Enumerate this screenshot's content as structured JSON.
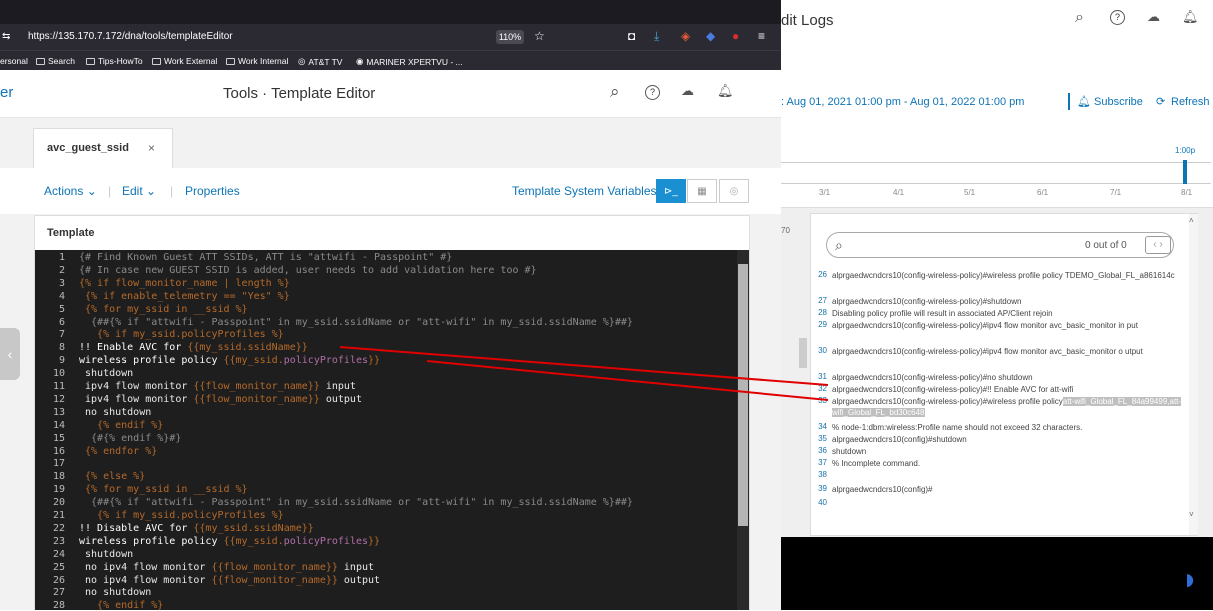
{
  "browser": {
    "url": "https://135.170.7.172/dna/tools/templateEditor",
    "zoom": "110%",
    "bookmarks": [
      "ersonal",
      "Search",
      "Tips-HowTo",
      "Work External",
      "Work Internal",
      "AT&T TV",
      "MARINER XPERTVU - ..."
    ]
  },
  "right_panel": {
    "title": "dit Logs",
    "date_range": ": Aug 01, 2021 01:00 pm - Aug 01, 2022 01:00 pm",
    "subscribe": "Subscribe",
    "refresh": "Refresh",
    "timeline_end": "1:00p",
    "ticks": [
      "3/1",
      "4/1",
      "5/1",
      "6/1",
      "7/1",
      "8/1"
    ],
    "side_num": "70",
    "search_count": "0 out of 0",
    "cli": [
      {
        "n": "26",
        "t": "alprgaedwcndcrs10(config-wireless-policy)#wireless profile policy TDEMO_Global_FL_a861614c"
      },
      {
        "n": "27",
        "t": "alprgaedwcndcrs10(config-wireless-policy)#shutdown"
      },
      {
        "n": "28",
        "t": "Disabling policy profile will result in associated AP/Client rejoin"
      },
      {
        "n": "29",
        "t": "alprgaedwcndcrs10(config-wireless-policy)#ipv4 flow monitor avc_basic_monitor in put"
      },
      {
        "n": "30",
        "t": "alprgaedwcndcrs10(config-wireless-policy)#ipv4 flow monitor avc_basic_monitor o utput"
      },
      {
        "n": "31",
        "t": "alprgaedwcndcrs10(config-wireless-policy)#no shutdown"
      },
      {
        "n": "32",
        "t": "alprgaedwcndcrs10(config-wireless-policy)#!! Enable AVC for att-wifi"
      },
      {
        "n": "33",
        "t": "alprgaedwcndcrs10(config-wireless-policy)#wireless profile policy",
        "hl": "att-wifi_Global_FL_84a99499,att-wifi_Global_FL_bd30c648"
      },
      {
        "n": "34",
        "t": "% node-1:dbm:wireless:Profile name should not exceed 32 characters."
      },
      {
        "n": "35",
        "t": "alprgaedwcndcrs10(config)#shutdown"
      },
      {
        "n": "36",
        "t": "shutdown"
      },
      {
        "n": "37",
        "t": "% Incomplete command."
      },
      {
        "n": "38",
        "t": ""
      },
      {
        "n": "39",
        "t": "alprgaedwcndcrs10(config)#"
      },
      {
        "n": "40",
        "t": ""
      }
    ]
  },
  "editor": {
    "app_fragment": "er",
    "title": "Tools · Template Editor",
    "tab": "avc_guest_ssid",
    "actions": "Actions",
    "edit": "Edit",
    "properties": "Properties",
    "sys_vars": "Template System Variables",
    "panel_title": "Template",
    "lines": [
      {
        "n": "1",
        "h": "<span class='c'>{# Find Known Guest ATT SSIDs, ATT is \"attwifi - Passpoint\" #}</span>"
      },
      {
        "n": "2",
        "h": "<span class='c'>{# In case new GUEST SSID is added, user needs to add validation here too #}</span>"
      },
      {
        "n": "3",
        "h": "<span class='o'>{% if flow_monitor_name | length %}</span>"
      },
      {
        "n": "4",
        "h": "<span class='o'> {% if enable_telemetry == \"Yes\" %}</span>"
      },
      {
        "n": "5",
        "h": "<span class='o'> {% for my_ssid in __ssid %}</span>"
      },
      {
        "n": "6",
        "h": "<span class='c'>  {##{% if \"attwifi - Passpoint\" in my_ssid.ssidName or \"att-wifi\" in my_ssid.ssidName %}##}</span>"
      },
      {
        "n": "7",
        "h": "<span class='o'>   {% if my_ssid.policyProfiles %}</span>"
      },
      {
        "n": "8",
        "h": "<span class='w'>!! Enable AVC for </span><span class='o'>{{my_ssid.ssidName}}</span>"
      },
      {
        "n": "9",
        "h": "<span class='w'>wireless profile policy </span><span class='o'>{{my_ssid.</span><span class='p'>policyProfiles</span><span class='o'>}}</span>"
      },
      {
        "n": "10",
        "h": " shutdown"
      },
      {
        "n": "11",
        "h": " ipv4 flow monitor <span class='o'>{{flow_monitor_name}}</span> input"
      },
      {
        "n": "12",
        "h": " ipv4 flow monitor <span class='o'>{{flow_monitor_name}}</span> output"
      },
      {
        "n": "13",
        "h": " no shutdown"
      },
      {
        "n": "14",
        "h": "<span class='o'>   {% endif %}</span>"
      },
      {
        "n": "15",
        "h": "<span class='c'>  {#{% endif %}#}</span>"
      },
      {
        "n": "16",
        "h": "<span class='o'> {% endfor %}</span>"
      },
      {
        "n": "17",
        "h": ""
      },
      {
        "n": "18",
        "h": "<span class='o'> {% else %}</span>"
      },
      {
        "n": "19",
        "h": "<span class='o'> {% for my_ssid in __ssid %}</span>"
      },
      {
        "n": "20",
        "h": "<span class='c'>  {##{% if \"attwifi - Passpoint\" in my_ssid.ssidName or \"att-wifi\" in my_ssid.ssidName %}##}</span>"
      },
      {
        "n": "21",
        "h": "<span class='o'>   {% if my_ssid.policyProfiles %}</span>"
      },
      {
        "n": "22",
        "h": "<span class='w'>!! Disable AVC for </span><span class='o'>{{my_ssid.ssidName}}</span>"
      },
      {
        "n": "23",
        "h": "<span class='w'>wireless profile policy </span><span class='o'>{{my_ssid.</span><span class='p'>policyProfiles</span><span class='o'>}}</span>"
      },
      {
        "n": "24",
        "h": " shutdown"
      },
      {
        "n": "25",
        "h": " no ipv4 flow monitor <span class='o'>{{flow_monitor_name}}</span> input"
      },
      {
        "n": "26",
        "h": " no ipv4 flow monitor <span class='o'>{{flow_monitor_name}}</span> output"
      },
      {
        "n": "27",
        "h": " no shutdown"
      },
      {
        "n": "28",
        "h": "<span class='o'>   {% endif %}</span>"
      }
    ]
  }
}
